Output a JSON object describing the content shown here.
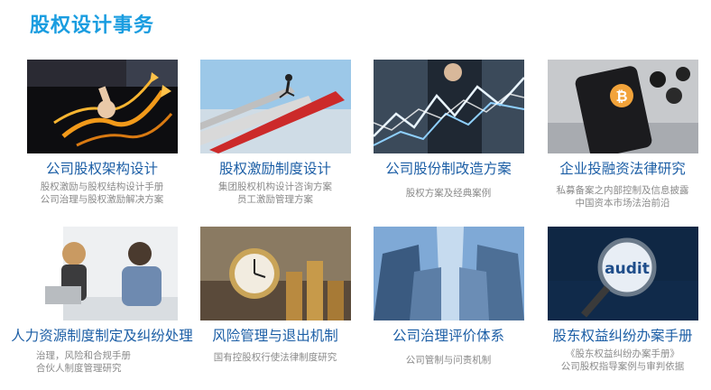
{
  "page": {
    "title": "股权设计事务"
  },
  "cards": [
    {
      "title": "公司股权架构设计",
      "desc": [
        "股权激励与股权结构设计手册",
        "公司治理与股权激励解决方案"
      ],
      "image": "hand-drawing-arrows-image"
    },
    {
      "title": "股权激励制度设计",
      "desc": [
        "集团股权机构设计咨询方案",
        "员工激励管理方案"
      ],
      "image": "running-man-arrows-image"
    },
    {
      "title": "公司股份制改造方案",
      "desc": [
        "股权方案及经典案例"
      ],
      "image": "chart-lines-businessman-image"
    },
    {
      "title": "企业投融资法律研究",
      "desc": [
        "私募备案之内部控制及信息披露",
        "中国资本市场法治前沿"
      ],
      "image": "bitcoin-phone-image"
    },
    {
      "title": "人力资源制度制定及纠纷处理",
      "desc": [
        "治理，风险和合规手册",
        "合伙人制度管理研究"
      ],
      "image": "office-meeting-image"
    },
    {
      "title": "风险管理与退出机制",
      "desc": [
        "国有控股权行使法律制度研究"
      ],
      "image": "clock-coins-image"
    },
    {
      "title": "公司治理评价体系",
      "desc": [
        "公司管制与问责机制"
      ],
      "image": "skyscrapers-image"
    },
    {
      "title": "股东权益纠纷办案手册",
      "desc": [
        "《股东权益纠纷办案手册》",
        "公司股权指导案例与审判依据"
      ],
      "image": "audit-magnifier-image",
      "audit_word": "audit"
    }
  ],
  "colors": {
    "title": "#1a9de0",
    "card_title": "#1d5fa6",
    "desc": "#8a8a8a"
  }
}
